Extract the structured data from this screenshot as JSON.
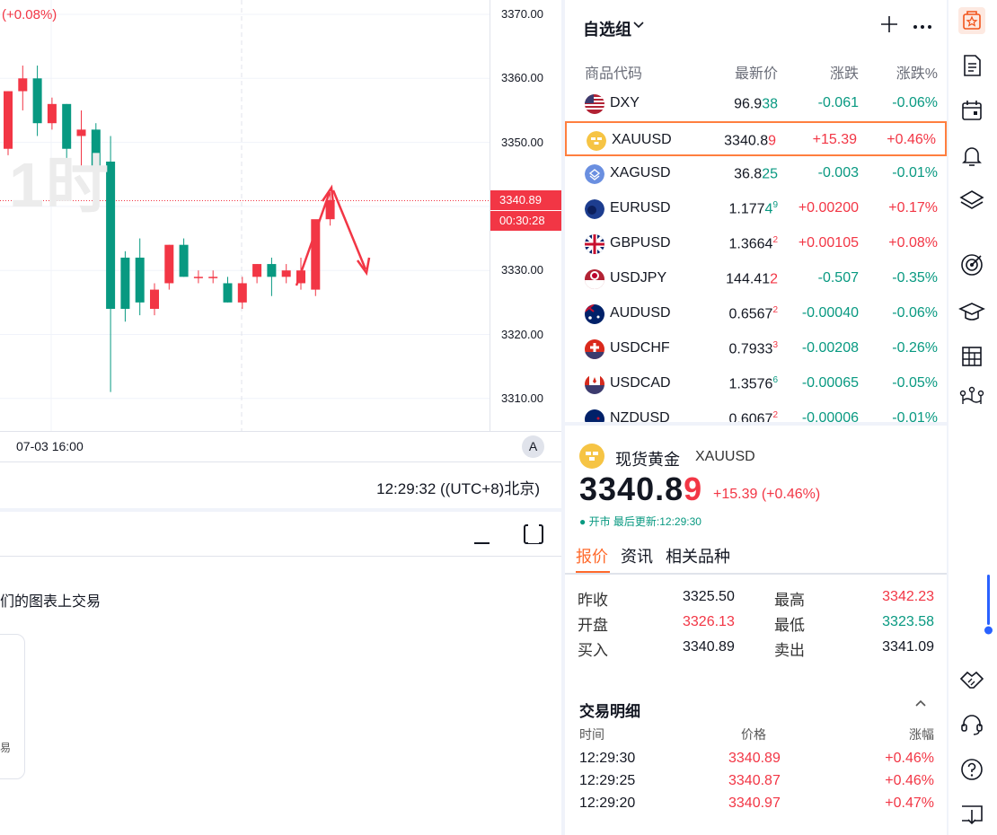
{
  "chart": {
    "change_label": "(+0.08%)",
    "watermark": "1时",
    "price_ticks": [
      "3370.00",
      "3360.00",
      "3350.00",
      "3330.00",
      "3320.00",
      "3310.00"
    ],
    "current_price_tag": "3340.89",
    "countdown": "00:30:28",
    "time_label": "07-03 16:00",
    "auto_scale": "A",
    "clock": "12:29:32 ((UTC+8)北京)",
    "up_color": "#f23645",
    "down_color": "#089981",
    "candles": [
      {
        "o": 3349,
        "h": 3358,
        "l": 3348,
        "c": 3358
      },
      {
        "o": 3358,
        "h": 3362,
        "l": 3355,
        "c": 3360
      },
      {
        "o": 3360,
        "h": 3362,
        "l": 3351,
        "c": 3353
      },
      {
        "o": 3353,
        "h": 3357,
        "l": 3352,
        "c": 3356
      },
      {
        "o": 3356,
        "h": 3356,
        "l": 3344,
        "c": 3349
      },
      {
        "o": 3351,
        "h": 3355,
        "l": 3346,
        "c": 3352
      },
      {
        "o": 3352,
        "h": 3353,
        "l": 3345,
        "c": 3346
      },
      {
        "o": 3347,
        "h": 3351,
        "l": 3311,
        "c": 3324
      },
      {
        "o": 3332,
        "h": 3333,
        "l": 3322,
        "c": 3324
      },
      {
        "o": 3332,
        "h": 3335,
        "l": 3323,
        "c": 3325
      },
      {
        "o": 3324,
        "h": 3328,
        "l": 3323,
        "c": 3327
      },
      {
        "o": 3328,
        "h": 3334,
        "l": 3327,
        "c": 3334
      },
      {
        "o": 3334,
        "h": 3335,
        "l": 3329,
        "c": 3329
      },
      {
        "o": 3329,
        "h": 3330,
        "l": 3328,
        "c": 3329
      },
      {
        "o": 3329,
        "h": 3330,
        "l": 3328,
        "c": 3329
      },
      {
        "o": 3328,
        "h": 3329,
        "l": 3325,
        "c": 3325
      },
      {
        "o": 3325,
        "h": 3329,
        "l": 3324,
        "c": 3328
      },
      {
        "o": 3329,
        "h": 3331,
        "l": 3328,
        "c": 3331
      },
      {
        "o": 3331,
        "h": 3332,
        "l": 3326,
        "c": 3329
      },
      {
        "o": 3329,
        "h": 3331,
        "l": 3328,
        "c": 3330
      },
      {
        "o": 3328,
        "h": 3332,
        "l": 3327,
        "c": 3330
      },
      {
        "o": 3327,
        "h": 3337,
        "l": 3326,
        "c": 3338
      },
      {
        "o": 3338,
        "h": 3342,
        "l": 3337,
        "c": 3341
      }
    ]
  },
  "bottom_panel": {
    "trade_hint": "们的图表上交易",
    "card_glyph": "易"
  },
  "watchlist": {
    "title": "自选组",
    "columns": [
      "商品代码",
      "最新价",
      "涨跌",
      "涨跌%"
    ],
    "rows": [
      {
        "symbol": "DXY",
        "price_main": "96.9",
        "price_tail": "38",
        "tail_dir": "down",
        "sup": "",
        "change": "-0.061",
        "pct": "-0.06%",
        "dir": "down",
        "flag": "us",
        "selected": false
      },
      {
        "symbol": "XAUUSD",
        "price_main": "3340.8",
        "price_tail": "9",
        "tail_dir": "up",
        "sup": "",
        "change": "+15.39",
        "pct": "+0.46%",
        "dir": "up",
        "flag": "gold",
        "selected": true
      },
      {
        "symbol": "XAGUSD",
        "price_main": "36.8",
        "price_tail": "25",
        "tail_dir": "down",
        "sup": "",
        "change": "-0.003",
        "pct": "-0.01%",
        "dir": "down",
        "flag": "silver",
        "selected": false
      },
      {
        "symbol": "EURUSD",
        "price_main": "1.177",
        "price_tail": "4",
        "tail_dir": "down",
        "sup": "9",
        "change": "+0.00200",
        "pct": "+0.17%",
        "dir": "up",
        "flag": "eu",
        "selected": false
      },
      {
        "symbol": "GBPUSD",
        "price_main": "1.3664",
        "price_tail": "",
        "tail_dir": "up",
        "sup": "2",
        "change": "+0.00105",
        "pct": "+0.08%",
        "dir": "up",
        "flag": "gb",
        "selected": false
      },
      {
        "symbol": "USDJPY",
        "price_main": "144.41",
        "price_tail": "2",
        "tail_dir": "up",
        "sup": "",
        "change": "-0.507",
        "pct": "-0.35%",
        "dir": "down",
        "flag": "jp",
        "selected": false
      },
      {
        "symbol": "AUDUSD",
        "price_main": "0.6567",
        "price_tail": "",
        "tail_dir": "up",
        "sup": "2",
        "change": "-0.00040",
        "pct": "-0.06%",
        "dir": "down",
        "flag": "au",
        "selected": false
      },
      {
        "symbol": "USDCHF",
        "price_main": "0.7933",
        "price_tail": "",
        "tail_dir": "up",
        "sup": "3",
        "change": "-0.00208",
        "pct": "-0.26%",
        "dir": "down",
        "flag": "ch",
        "selected": false
      },
      {
        "symbol": "USDCAD",
        "price_main": "1.3576",
        "price_tail": "",
        "tail_dir": "down",
        "sup": "6",
        "change": "-0.00065",
        "pct": "-0.05%",
        "dir": "down",
        "flag": "ca",
        "selected": false
      },
      {
        "symbol": "NZDUSD",
        "price_main": "0.6067",
        "price_tail": "",
        "tail_dir": "up",
        "sup": "2",
        "change": "-0.00006",
        "pct": "-0.01%",
        "dir": "down",
        "flag": "nz",
        "selected": false
      }
    ]
  },
  "details": {
    "name": "现货黄金",
    "symbol": "XAUUSD",
    "price_main": "3340.8",
    "price_tail": "9",
    "change": "+15.39 (+0.46%)",
    "status": "● 开市 最后更新:12:29:30",
    "tabs": [
      "报价",
      "资讯",
      "相关品种"
    ],
    "quotes": [
      {
        "label": "昨收",
        "value": "3325.50",
        "dir": "neutral",
        "label2": "最高",
        "value2": "3342.23",
        "dir2": "up"
      },
      {
        "label": "开盘",
        "value": "3326.13",
        "dir": "up",
        "label2": "最低",
        "value2": "3323.58",
        "dir2": "down"
      },
      {
        "label": "买入",
        "value": "3340.89",
        "dir": "neutral",
        "label2": "卖出",
        "value2": "3341.09",
        "dir2": "neutral"
      }
    ],
    "trades_title": "交易明细",
    "trades_headers": [
      "时间",
      "价格",
      "涨幅"
    ],
    "trades": [
      {
        "time": "12:29:30",
        "price": "3340.89",
        "change": "+0.46%"
      },
      {
        "time": "12:29:25",
        "price": "3340.87",
        "change": "+0.46%"
      },
      {
        "time": "12:29:20",
        "price": "3340.97",
        "change": "+0.47%"
      }
    ]
  },
  "right_toolbar": {
    "icons": [
      "watchlist-icon",
      "news-icon",
      "calendar-icon",
      "alert-icon",
      "layers-icon",
      "target-icon",
      "education-icon",
      "grid-icon",
      "network-icon",
      "handshake-icon",
      "support-icon",
      "help-icon",
      "download-icon"
    ]
  }
}
